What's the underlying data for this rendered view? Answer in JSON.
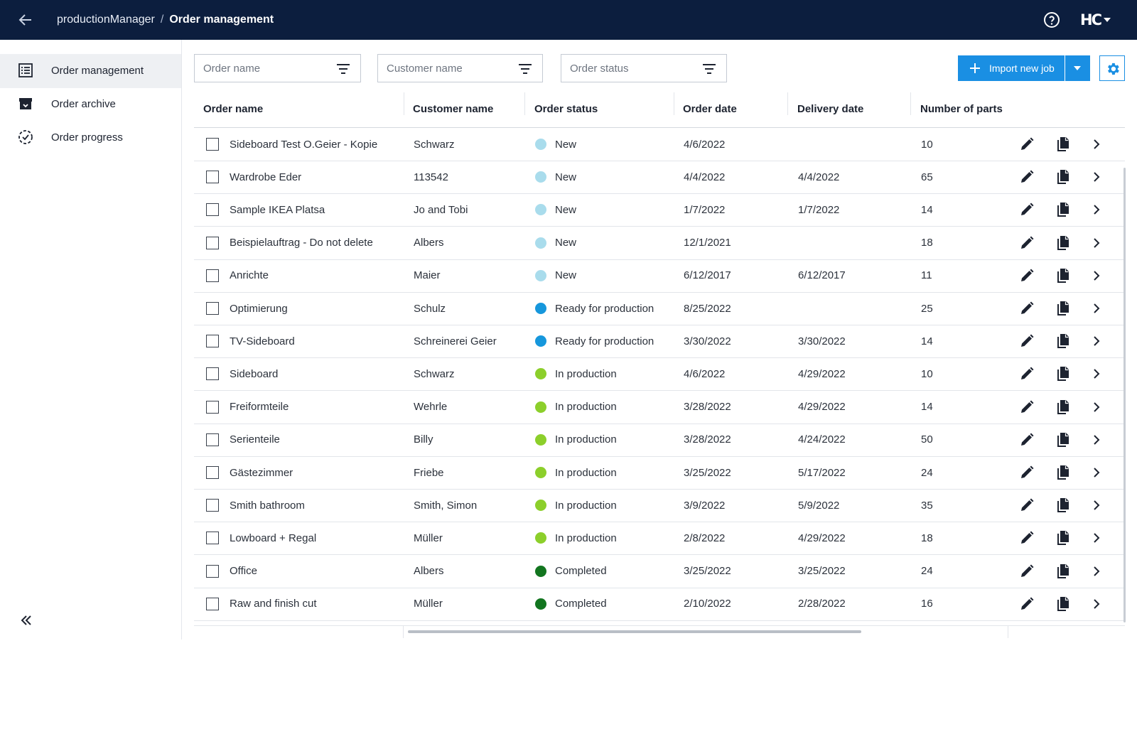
{
  "topbar": {
    "app_name": "productionManager",
    "separator": "/",
    "current_page": "Order management",
    "brand_logo": "HC"
  },
  "sidebar": {
    "items": [
      {
        "label": "Order management",
        "icon": "list-icon",
        "active": true
      },
      {
        "label": "Order archive",
        "icon": "archive-icon",
        "active": false
      },
      {
        "label": "Order progress",
        "icon": "progress-icon",
        "active": false
      }
    ]
  },
  "filters": {
    "order_name": {
      "placeholder": "Order name",
      "value": ""
    },
    "customer_name": {
      "placeholder": "Customer name",
      "value": ""
    },
    "order_status": {
      "placeholder": "Order status",
      "value": ""
    }
  },
  "toolbar": {
    "import_label": "Import new job"
  },
  "colors": {
    "topbar_bg": "#0c1e3e",
    "accent": "#1a8fe3",
    "status_new": "#a9dcec",
    "status_ready": "#1697dc",
    "status_in_production": "#8ccf2b",
    "status_completed": "#12751f"
  },
  "table": {
    "columns": [
      "Order name",
      "Customer name",
      "Order status",
      "Order date",
      "Delivery date",
      "Number of parts"
    ],
    "rows": [
      {
        "order_name": "Sideboard Test O.Geier - Kopie",
        "customer": "Schwarz",
        "status": "New",
        "order_date": "4/6/2022",
        "delivery_date": "",
        "parts": "10"
      },
      {
        "order_name": "Wardrobe Eder",
        "customer": "113542",
        "status": "New",
        "order_date": "4/4/2022",
        "delivery_date": "4/4/2022",
        "parts": "65"
      },
      {
        "order_name": "Sample IKEA Platsa",
        "customer": "Jo and Tobi",
        "status": "New",
        "order_date": "1/7/2022",
        "delivery_date": "1/7/2022",
        "parts": "14"
      },
      {
        "order_name": "Beispielauftrag - Do not delete",
        "customer": "Albers",
        "status": "New",
        "order_date": "12/1/2021",
        "delivery_date": "",
        "parts": "18"
      },
      {
        "order_name": "Anrichte",
        "customer": "Maier",
        "status": "New",
        "order_date": "6/12/2017",
        "delivery_date": "6/12/2017",
        "parts": "11"
      },
      {
        "order_name": "Optimierung",
        "customer": "Schulz",
        "status": "Ready for production",
        "order_date": "8/25/2022",
        "delivery_date": "",
        "parts": "25"
      },
      {
        "order_name": "TV-Sideboard",
        "customer": "Schreinerei Geier",
        "status": "Ready for production",
        "order_date": "3/30/2022",
        "delivery_date": "3/30/2022",
        "parts": "14"
      },
      {
        "order_name": "Sideboard",
        "customer": "Schwarz",
        "status": "In production",
        "order_date": "4/6/2022",
        "delivery_date": "4/29/2022",
        "parts": "10"
      },
      {
        "order_name": "Freiformteile",
        "customer": "Wehrle",
        "status": "In production",
        "order_date": "3/28/2022",
        "delivery_date": "4/29/2022",
        "parts": "14"
      },
      {
        "order_name": "Serienteile",
        "customer": "Billy",
        "status": "In production",
        "order_date": "3/28/2022",
        "delivery_date": "4/24/2022",
        "parts": "50"
      },
      {
        "order_name": "Gästezimmer",
        "customer": "Friebe",
        "status": "In production",
        "order_date": "3/25/2022",
        "delivery_date": "5/17/2022",
        "parts": "24"
      },
      {
        "order_name": "Smith bathroom",
        "customer": "Smith, Simon",
        "status": "In production",
        "order_date": "3/9/2022",
        "delivery_date": "5/9/2022",
        "parts": "35"
      },
      {
        "order_name": "Lowboard + Regal",
        "customer": "Müller",
        "status": "In production",
        "order_date": "2/8/2022",
        "delivery_date": "4/29/2022",
        "parts": "18"
      },
      {
        "order_name": "Office",
        "customer": "Albers",
        "status": "Completed",
        "order_date": "3/25/2022",
        "delivery_date": "3/25/2022",
        "parts": "24"
      },
      {
        "order_name": "Raw and finish cut",
        "customer": "Müller",
        "status": "Completed",
        "order_date": "2/10/2022",
        "delivery_date": "2/28/2022",
        "parts": "16"
      }
    ]
  }
}
